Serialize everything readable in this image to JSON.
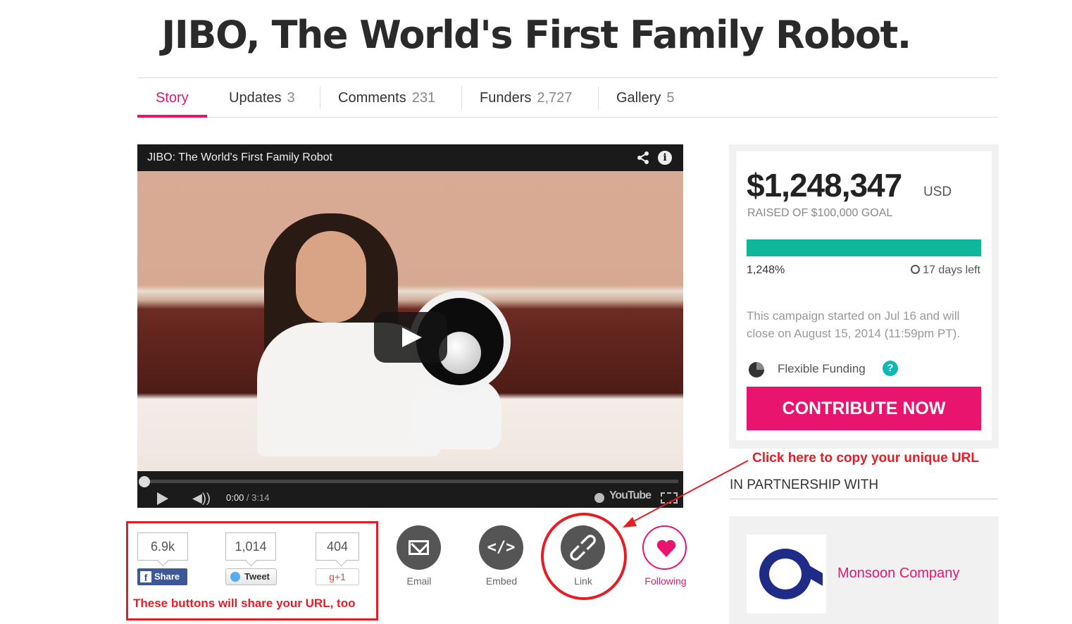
{
  "page_title": "JIBO, The World's First Family Robot.",
  "tabs": [
    {
      "label": "Story",
      "count": ""
    },
    {
      "label": "Updates",
      "count": "3"
    },
    {
      "label": "Comments",
      "count": "231"
    },
    {
      "label": "Funders",
      "count": "2,727"
    },
    {
      "label": "Gallery",
      "count": "5"
    }
  ],
  "video": {
    "title": "JIBO: The World's First Family Robot",
    "current_time": "0:00",
    "duration": "/ 3:14",
    "played_fraction": 0.0,
    "youtube_label": "YouTube"
  },
  "social": {
    "facebook_count": "6.9k",
    "facebook_label": "Share",
    "twitter_count": "1,014",
    "twitter_label": "Tweet",
    "gplus_count": "404",
    "gplus_label": "+1",
    "note": "These buttons will share your URL, too"
  },
  "actions": {
    "email_label": "Email",
    "embed_label": "Embed",
    "link_label": "Link",
    "following_label": "Following"
  },
  "funding": {
    "amount": "$1,248,347",
    "currency": "USD",
    "raised_text": "RAISED OF $100,000 GOAL",
    "percent_label": "1,248%",
    "percent_value": 1248,
    "days_left": "17 days left",
    "campaign_text": "This campaign started on Jul 16 and will close on August 15, 2014 (11:59pm PT).",
    "funding_type": "Flexible Funding",
    "help_icon": "?",
    "contribute_label": "CONTRIBUTE NOW"
  },
  "annotations": {
    "url_note": "Click here to copy your unique URL"
  },
  "partner": {
    "heading": "IN PARTNERSHIP WITH",
    "name": "Monsoon Company"
  },
  "colors": {
    "accent": "#e8146d",
    "progress": "#0fb79a",
    "annotation_red": "#e81c24",
    "partner_blue": "#1e2b87"
  }
}
